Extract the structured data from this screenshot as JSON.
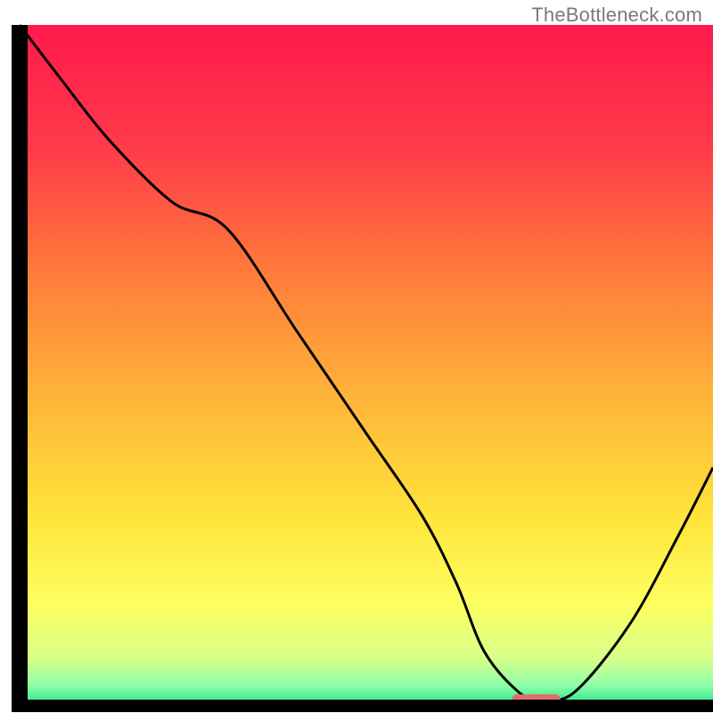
{
  "watermark": "TheBottleneck.com",
  "chart_data": {
    "type": "line",
    "title": "",
    "xlabel": "",
    "ylabel": "",
    "xlim": [
      0,
      100
    ],
    "ylim": [
      0,
      100
    ],
    "grid": false,
    "legend": false,
    "background_gradient_stops": [
      {
        "offset": 0.0,
        "color": "#ff1a4b"
      },
      {
        "offset": 0.18,
        "color": "#ff3a4a"
      },
      {
        "offset": 0.36,
        "color": "#ff7a3a"
      },
      {
        "offset": 0.55,
        "color": "#ffb53a"
      },
      {
        "offset": 0.72,
        "color": "#ffe33a"
      },
      {
        "offset": 0.85,
        "color": "#fdff60"
      },
      {
        "offset": 0.93,
        "color": "#d8ff8a"
      },
      {
        "offset": 0.97,
        "color": "#8effa8"
      },
      {
        "offset": 1.0,
        "color": "#1fe28a"
      }
    ],
    "series": [
      {
        "name": "bottleneck-curve",
        "x": [
          0,
          6,
          13,
          22,
          30,
          40,
          50,
          58,
          63,
          67,
          72,
          75,
          80,
          88,
          95,
          100
        ],
        "y": [
          100,
          92,
          83,
          74,
          70,
          55,
          40,
          28,
          18,
          8,
          2,
          1,
          2,
          12,
          25,
          35
        ]
      }
    ],
    "marker": {
      "name": "optimal-range-marker",
      "x_start": 71,
      "x_end": 78,
      "y": 0.5,
      "color": "#e06a6a"
    },
    "frame_color": "#000000",
    "curve_color": "#000000",
    "curve_width": 3
  }
}
